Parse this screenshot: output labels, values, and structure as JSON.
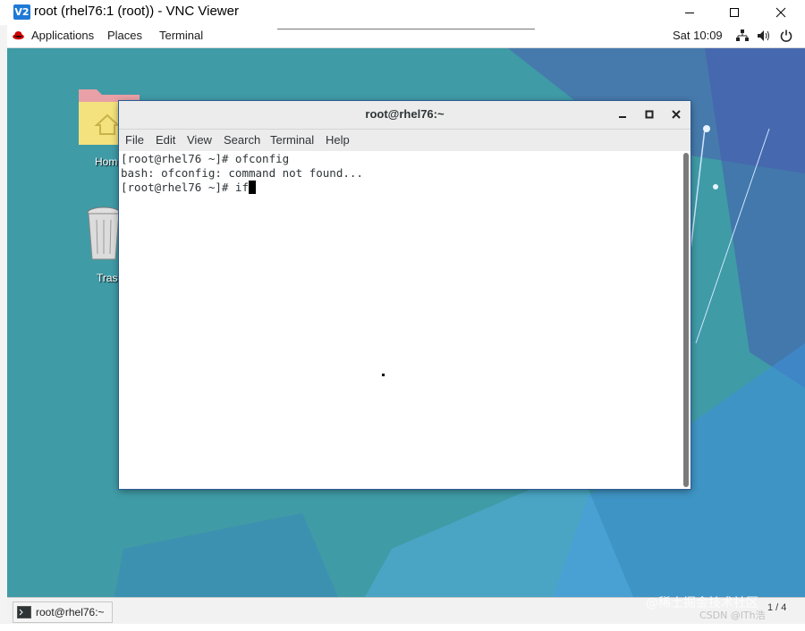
{
  "vnc": {
    "logo": "V2",
    "title": "root (rhel76:1 (root)) - VNC Viewer"
  },
  "topbar": {
    "applications": "Applications",
    "places": "Places",
    "terminal": "Terminal",
    "clock": "Sat 10:09"
  },
  "desktop": {
    "icons": [
      {
        "label": "Hom",
        "icon": "home-folder-icon"
      },
      {
        "label": "Tras",
        "icon": "trash-icon"
      }
    ]
  },
  "terminal": {
    "title": "root@rhel76:~",
    "menu": [
      "File",
      "Edit",
      "View",
      "Search",
      "Terminal",
      "Help"
    ],
    "lines": [
      "[root@rhel76 ~]# ofconfig",
      "bash: ofconfig: command not found...",
      "[root@rhel76 ~]# if"
    ]
  },
  "taskbar": {
    "window_label": "root@rhel76:~",
    "workspace": "1 / 4"
  },
  "watermark": {
    "line1": "@稀土掘金技术社区",
    "line2": "CSDN @lTh浩"
  },
  "colors": {
    "desktop": "#3f9ba6",
    "accent": "#2e5c94"
  }
}
